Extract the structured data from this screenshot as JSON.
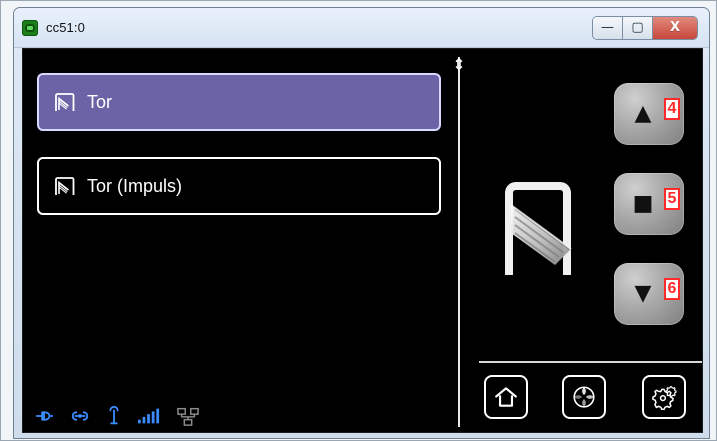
{
  "window": {
    "title": "cc51:0",
    "controls": {
      "minimize": "—",
      "maximize": "▢",
      "close": "X"
    }
  },
  "list": {
    "items": [
      {
        "label": "Tor",
        "selected": true
      },
      {
        "label": "Tor (Impuls)",
        "selected": false
      }
    ]
  },
  "controls": {
    "up": {
      "glyph": "▲",
      "badge": "4"
    },
    "stop": {
      "glyph": "■",
      "badge": "5"
    },
    "down": {
      "glyph": "▼",
      "badge": "6"
    }
  },
  "colors": {
    "selected_item_bg": "#6a64a7",
    "status_blue": "#3a8dff",
    "status_gray": "#8a8a8a",
    "badge_red": "#ff2b2b"
  },
  "icons": {
    "app": "app-icon",
    "garage_small": "garage-door-icon",
    "garage_large": "garage-door-large-icon",
    "home": "home-icon",
    "fan": "fan-icon",
    "settings": "settings-gears-icon",
    "status": [
      "power-plug-icon",
      "link-icon",
      "antenna-icon",
      "signal-bars-icon",
      "network-icon"
    ]
  }
}
